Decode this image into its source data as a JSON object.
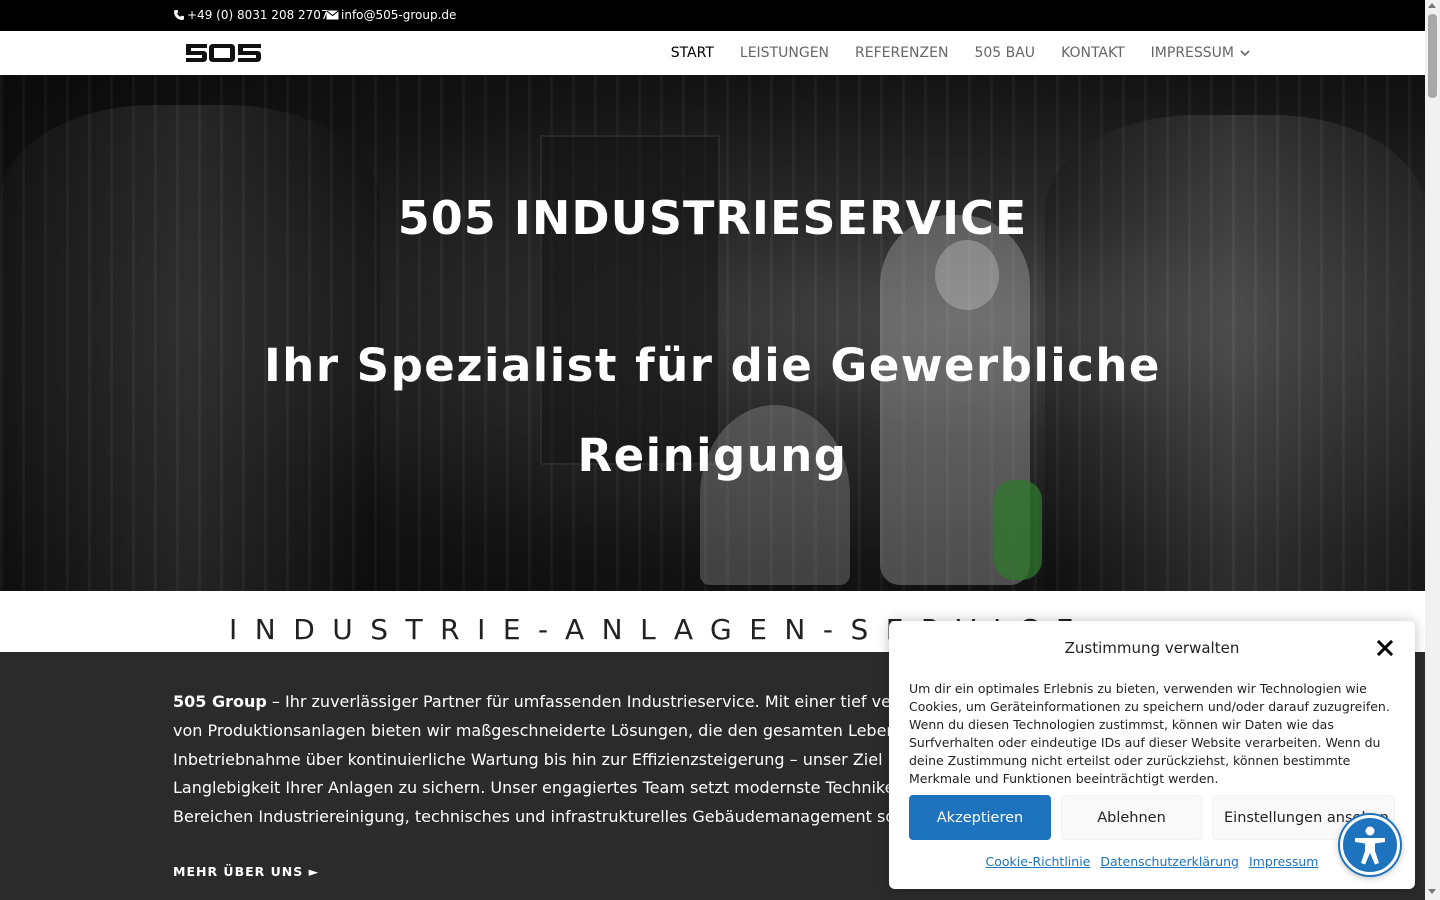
{
  "topbar": {
    "phone": "+49 (0) 8031 208 2707",
    "email": "info@505-group.de"
  },
  "header": {
    "logo_text": "505",
    "nav": [
      {
        "label": "START",
        "active": true
      },
      {
        "label": "LEISTUNGEN"
      },
      {
        "label": "REFERENZEN"
      },
      {
        "label": "505 BAU"
      },
      {
        "label": "KONTAKT"
      },
      {
        "label": "IMPRESSUM",
        "has_dropdown": true
      }
    ]
  },
  "hero": {
    "title": "505 INDUSTRIESERVICE",
    "subtitle": "Ihr Spezialist für die Gewerbliche Reinigung"
  },
  "section": {
    "heading": "INDUSTRIE-ANLAGEN-SERVICE"
  },
  "about": {
    "brand": "505 Group",
    "text": " – Ihr zuverlässiger Partner für umfassenden Industrieservice. Mit einer tief verwurzelten Expertise in der Instandhaltung von Produktionsanlagen bieten wir maßgeschneiderte Lösungen, die den gesamten Lebenszyklus Ihrer Anlagen abdecken. Von der Inbetriebnahme über kontinuierliche Wartung bis hin zur Effizienzsteigerung – unser Ziel ist es, die Leistungsfähigkeit und Langlebigkeit Ihrer Anlagen zu sichern. Unser engagiertes Team setzt modernste Techniken ein und bietet Ihnen Leistungen in den Bereichen Industriereinigung, technisches und infrastrukturelles Gebäudemanagement sowie Umwelttechnik.",
    "more_link": "MEHR ÜBER UNS ►"
  },
  "cookie_modal": {
    "title": "Zustimmung verwalten",
    "text": "Um dir ein optimales Erlebnis zu bieten, verwenden wir Technologien wie Cookies, um Geräteinformationen zu speichern und/oder darauf zuzugreifen. Wenn du diesen Technologien zustimmst, können wir Daten wie das Surfverhalten oder eindeutige IDs auf dieser Website verarbeiten. Wenn du deine Zustimmung nicht erteilst oder zurückziehst, können bestimmte Merkmale und Funktionen beeinträchtigt werden.",
    "accept": "Akzeptieren",
    "deny": "Ablehnen",
    "settings": "Einstellungen ansehen",
    "links": [
      "Cookie-Richtlinie",
      "Datenschutzerklärung",
      "Impressum"
    ]
  },
  "colors": {
    "accent": "#1e73be",
    "dark_section": "#2b2b2b",
    "topbar": "#000000"
  },
  "icons": [
    "phone-icon",
    "mail-icon",
    "chevron-down-icon",
    "close-icon",
    "accessibility-icon"
  ]
}
